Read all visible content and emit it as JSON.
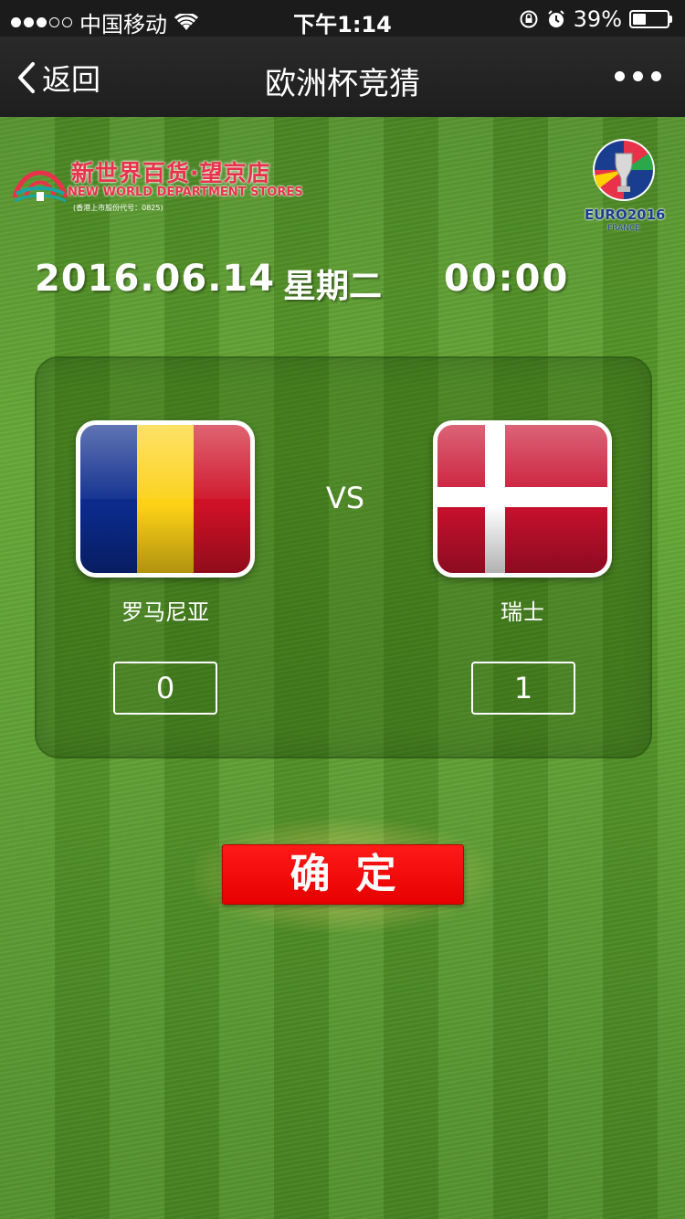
{
  "status_bar": {
    "carrier": "中国移动",
    "time": "下午1:14",
    "battery_percent": "39%",
    "battery_level": 0.39
  },
  "nav": {
    "back_label": "返回",
    "title": "欧洲杯竞猜"
  },
  "brand": {
    "name": "新世界百货·望京店",
    "name_en": "NEW WORLD DEPARTMENT STORES",
    "stock_code": "(香港上市股份代号：0825)"
  },
  "euro_logo": {
    "title": "EURO2016",
    "subtitle": "FRANCE"
  },
  "match": {
    "date": "2016.06.14",
    "weekday": "星期二",
    "time": "00:00",
    "vs": "VS",
    "home": {
      "name": "罗马尼亚",
      "score": "0",
      "flag_colors": [
        "#0b2a8c",
        "#fcd116",
        "#ce1126"
      ]
    },
    "away": {
      "name": "瑞士",
      "score": "1",
      "flag_colors": [
        "#c8102e",
        "#ffffff"
      ]
    }
  },
  "confirm_label": "确定"
}
